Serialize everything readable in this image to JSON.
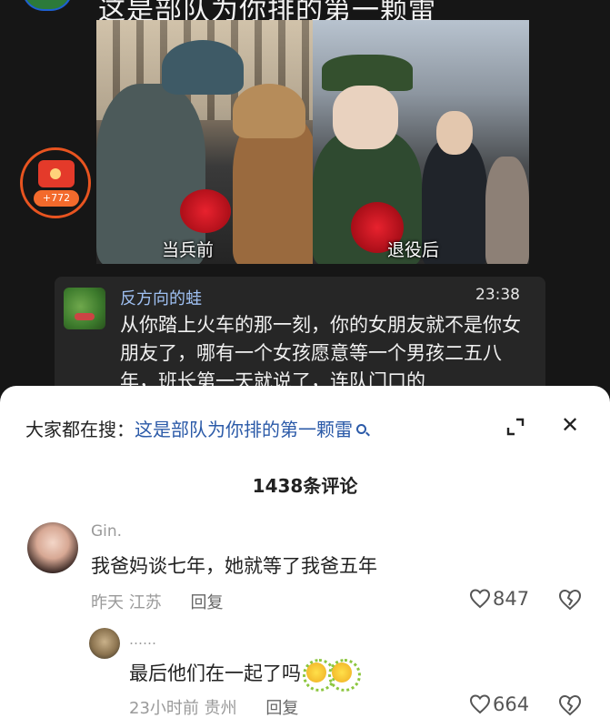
{
  "video": {
    "caption": "这是部队为你排的第一颗雷",
    "photo_left_label": "当兵前",
    "photo_right_label": "退役后",
    "red_packet_count": "+772"
  },
  "overlay_reply": {
    "user": "反方向的蛙",
    "time": "23:38",
    "text": "从你踏上火车的那一刻，你的女朋友就不是你女朋友了，哪有一个女孩愿意等一个男孩二五八年，班长第一天就说了，连队门口的"
  },
  "sheet": {
    "search_prefix": "大家都在搜：",
    "search_query": "这是部队为你排的第一颗雷",
    "comment_count_title": "1438条评论"
  },
  "comments": [
    {
      "user": "Gin.",
      "text": "我爸妈谈七年，她就等了我爸五年",
      "time": "昨天",
      "location": "江苏",
      "reply_label": "回复",
      "likes": "847"
    },
    {
      "user": "……",
      "text": "最后他们在一起了吗",
      "time": "23小时前",
      "location": "贵州",
      "reply_label": "回复",
      "likes": "664"
    }
  ],
  "colors": {
    "link": "#2b5aa8",
    "red_packet_ring": "#e85420",
    "reply_username": "#9fc0f2"
  }
}
